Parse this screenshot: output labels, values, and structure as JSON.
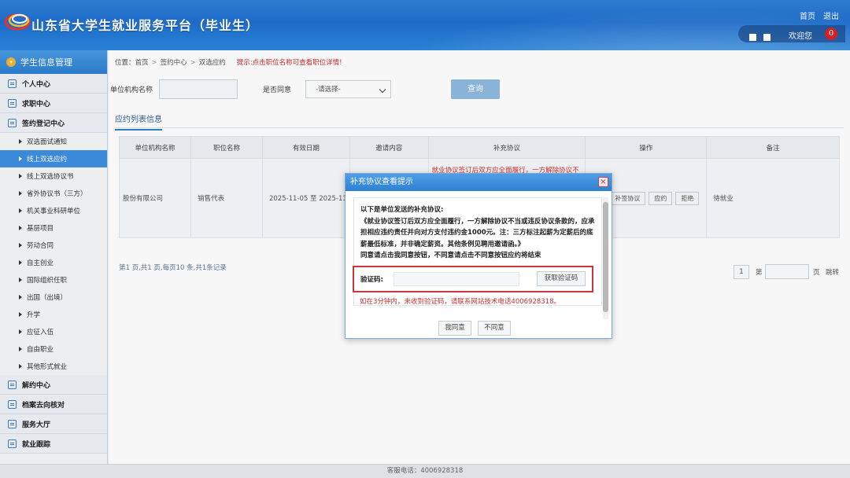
{
  "header": {
    "title": "山东省大学生就业服务平台（毕业生）",
    "home_link": "首页",
    "logout_link": "退出",
    "welcome": "欢迎您",
    "badge_count": "0"
  },
  "sidebar": {
    "head": "学生信息管理",
    "sections": [
      {
        "label": "个人中心"
      },
      {
        "label": "求职中心"
      },
      {
        "label": "签约登记中心"
      }
    ],
    "items": [
      {
        "label": "双选面试通知"
      },
      {
        "label": "线上双选应约"
      },
      {
        "label": "线上双选协议书"
      },
      {
        "label": "省外协议书（三方）"
      },
      {
        "label": "机关事业科研单位"
      },
      {
        "label": "基层项目"
      },
      {
        "label": "劳动合同"
      },
      {
        "label": "自主创业"
      },
      {
        "label": "国际组织任职"
      },
      {
        "label": "出国（出境）"
      },
      {
        "label": "升学"
      },
      {
        "label": "应征入伍"
      },
      {
        "label": "自由职业"
      },
      {
        "label": "其他形式就业"
      }
    ],
    "bottom_sections": [
      {
        "label": "解约中心"
      },
      {
        "label": "档案去向核对"
      },
      {
        "label": "服务大厅"
      },
      {
        "label": "就业跟踪"
      }
    ]
  },
  "breadcrumb": {
    "prefix": "位置：",
    "home": "首页",
    "level2": "签约中心",
    "level3": "双选应约",
    "tip": "提示:点击职位名称可查看职位详情!"
  },
  "filters": {
    "org_label": "单位机构名称",
    "agree_label": "是否同意",
    "agree_select": "-请选择-",
    "query_button": "查询"
  },
  "tab_title": "应约列表信息",
  "table": {
    "headers": [
      "单位机构名称",
      "职位名称",
      "有效日期",
      "邀请内容",
      "补充协议",
      "操作",
      "备注"
    ],
    "row": {
      "org": "股份有限公司",
      "position": "销售代表",
      "dates": "2025-11-05 至 2025-11-",
      "supplement": "就业协议签订后双方应全面履行，一方解除协议不",
      "ops": [
        "补签协议",
        "应约",
        "拒绝"
      ],
      "remark": "待就业"
    }
  },
  "pager": {
    "summary": "第1 页,共1 页,每页10 条,共1条记录",
    "current": "1",
    "page_prefix": "第",
    "page_suffix": "页",
    "jump": "跳转"
  },
  "footer": {
    "text": "客服电话：4006928318"
  },
  "modal": {
    "title": "补充协议查看提示",
    "close": "×",
    "intro": "以下是单位发送的补充协议:",
    "content": "《就业协议签订后双方应全面履行，一方解除协议不当或违反协议条款的，应承担相应违约责任并向对方支付违约金1000元。注：三方标注起薪为定薪后的底薪最低标准，并非确定薪资。其他条例见聘用邀请函。》",
    "instruction": "同意请点击我同意按钮，不同意请点击不同意按钮应约将结束",
    "code_label": "验证码:",
    "get_code_button": "获取验证码",
    "note": "如在3分钟内，未收到验证码，请联系网站技术电话4006928318。",
    "agree_button": "我同意",
    "disagree_button": "不同意"
  }
}
